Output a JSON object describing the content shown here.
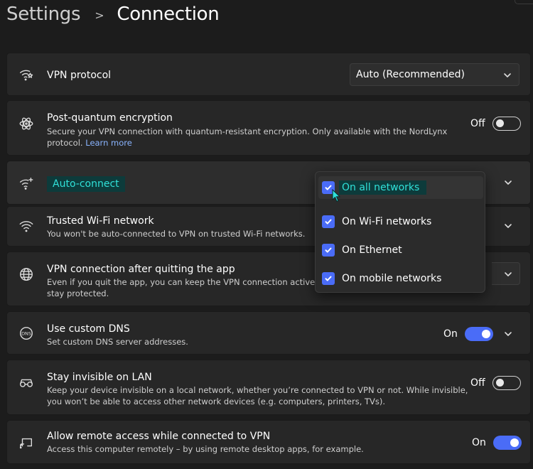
{
  "header": {
    "root": "Settings",
    "separator": ">",
    "current": "Connection"
  },
  "rows": {
    "vpn_protocol": {
      "icon": "vpn-protocol-icon",
      "title": "VPN protocol",
      "select_value": "Auto (Recommended)"
    },
    "post_quantum": {
      "icon": "atom-icon",
      "title": "Post-quantum encryption",
      "desc_line1": "Secure your VPN connection with quantum-resistant encryption. Only available with the NordLynx",
      "desc_line2": "protocol.",
      "link": "Learn more",
      "state": "Off"
    },
    "auto_connect": {
      "icon": "wifi-sparkle-icon",
      "title": "Auto-connect"
    },
    "trusted_wifi": {
      "icon": "wifi-icon",
      "title": "Trusted Wi-Fi network",
      "desc": "You won't be auto-connected to VPN on trusted Wi-Fi networks."
    },
    "after_quit": {
      "icon": "globe-icon",
      "title": "VPN connection after quitting the app",
      "desc_line1": "Even if you quit the app, you can keep the VPN connection active in the",
      "desc_line2": "stay protected."
    },
    "custom_dns": {
      "icon": "dns-icon",
      "title": "Use custom DNS",
      "desc": "Set custom DNS server addresses.",
      "state": "On"
    },
    "invisible_lan": {
      "icon": "glasses-icon",
      "title": "Stay invisible on LAN",
      "desc_line1": "Keep your device invisible on a local network, whether you’re connected to VPN or not. While invisible,",
      "desc_line2": "you won’t be able to access other network devices (e.g. computers, printers, TVs).",
      "state": "Off"
    },
    "remote_access": {
      "icon": "remote-screen-icon",
      "title": "Allow remote access while connected to VPN",
      "desc": "Access this computer remotely – by using remote desktop apps, for example.",
      "state": "On"
    }
  },
  "dropdown": {
    "items": [
      {
        "label": "On all networks",
        "checked": true
      },
      {
        "label": "On Wi-Fi networks",
        "checked": true
      },
      {
        "label": "On Ethernet",
        "checked": true
      },
      {
        "label": "On mobile networks",
        "checked": true
      }
    ]
  },
  "colors": {
    "accent": "#4a6cf7",
    "highlight_bg": "#0d3b3b",
    "highlight_text": "#30e0d8",
    "link": "#8ab4ff"
  }
}
